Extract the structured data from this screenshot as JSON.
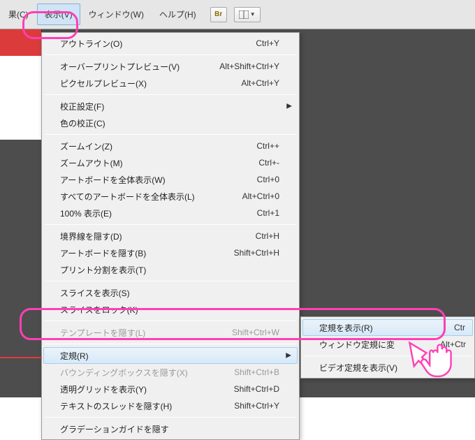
{
  "menubar": {
    "items": [
      {
        "label": "果(C)"
      },
      {
        "label": "表示(V)"
      },
      {
        "label": "ウィンドウ(W)"
      },
      {
        "label": "ヘルプ(H)"
      }
    ],
    "br_label": "Br"
  },
  "view_menu": {
    "groups": [
      [
        {
          "label": "アウトライン(O)",
          "shortcut": "Ctrl+Y"
        }
      ],
      [
        {
          "label": "オーバープリントプレビュー(V)",
          "shortcut": "Alt+Shift+Ctrl+Y"
        },
        {
          "label": "ピクセルプレビュー(X)",
          "shortcut": "Alt+Ctrl+Y"
        }
      ],
      [
        {
          "label": "校正設定(F)",
          "submenu": true
        },
        {
          "label": "色の校正(C)"
        }
      ],
      [
        {
          "label": "ズームイン(Z)",
          "shortcut": "Ctrl++"
        },
        {
          "label": "ズームアウト(M)",
          "shortcut": "Ctrl+-"
        },
        {
          "label": "アートボードを全体表示(W)",
          "shortcut": "Ctrl+0"
        },
        {
          "label": "すべてのアートボードを全体表示(L)",
          "shortcut": "Alt+Ctrl+0"
        },
        {
          "label": "100% 表示(E)",
          "shortcut": "Ctrl+1"
        }
      ],
      [
        {
          "label": "境界線を隠す(D)",
          "shortcut": "Ctrl+H"
        },
        {
          "label": "アートボードを隠す(B)",
          "shortcut": "Shift+Ctrl+H"
        },
        {
          "label": "プリント分割を表示(T)"
        }
      ],
      [
        {
          "label": "スライスを表示(S)"
        },
        {
          "label": "スライスをロック(K)"
        }
      ],
      [
        {
          "label": "テンプレートを隠す(L)",
          "shortcut": "Shift+Ctrl+W",
          "disabled": true
        }
      ],
      [
        {
          "label": "定規(R)",
          "submenu": true,
          "hover": true
        },
        {
          "label": "バウンディングボックスを隠す(X)",
          "shortcut": "Shift+Ctrl+B",
          "disabled": true
        },
        {
          "label": "透明グリッドを表示(Y)",
          "shortcut": "Shift+Ctrl+D"
        },
        {
          "label": "テキストのスレッドを隠す(H)",
          "shortcut": "Shift+Ctrl+Y"
        }
      ],
      [
        {
          "label": "グラデーションガイドを隠す"
        }
      ]
    ]
  },
  "ruler_submenu": {
    "items": [
      {
        "label": "定規を表示(R)",
        "shortcut": "Ctr",
        "hover": true
      },
      {
        "label": "ウィンドウ定規に変",
        "shortcut": "Alt+Ctr"
      },
      {
        "label": "ビデオ定規を表示(V)"
      }
    ]
  }
}
